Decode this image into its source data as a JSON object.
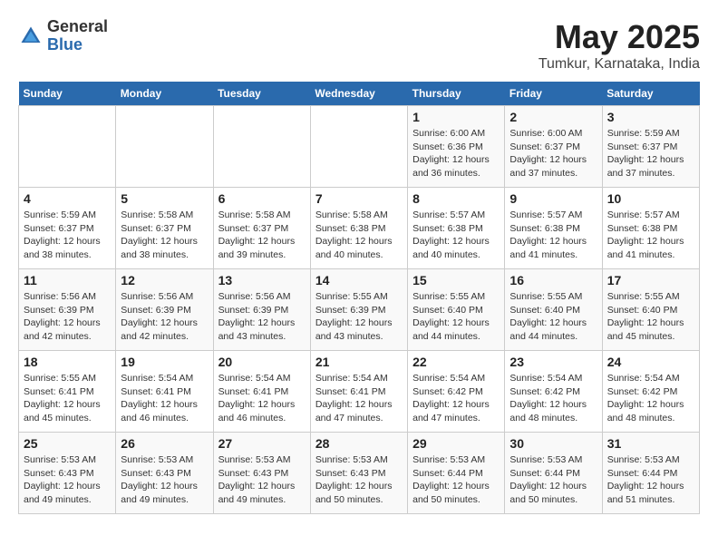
{
  "header": {
    "logo_general": "General",
    "logo_blue": "Blue",
    "month_title": "May 2025",
    "location": "Tumkur, Karnataka, India"
  },
  "days_of_week": [
    "Sunday",
    "Monday",
    "Tuesday",
    "Wednesday",
    "Thursday",
    "Friday",
    "Saturday"
  ],
  "weeks": [
    [
      {
        "day": "",
        "info": ""
      },
      {
        "day": "",
        "info": ""
      },
      {
        "day": "",
        "info": ""
      },
      {
        "day": "",
        "info": ""
      },
      {
        "day": "1",
        "info": "Sunrise: 6:00 AM\nSunset: 6:36 PM\nDaylight: 12 hours\nand 36 minutes."
      },
      {
        "day": "2",
        "info": "Sunrise: 6:00 AM\nSunset: 6:37 PM\nDaylight: 12 hours\nand 37 minutes."
      },
      {
        "day": "3",
        "info": "Sunrise: 5:59 AM\nSunset: 6:37 PM\nDaylight: 12 hours\nand 37 minutes."
      }
    ],
    [
      {
        "day": "4",
        "info": "Sunrise: 5:59 AM\nSunset: 6:37 PM\nDaylight: 12 hours\nand 38 minutes."
      },
      {
        "day": "5",
        "info": "Sunrise: 5:58 AM\nSunset: 6:37 PM\nDaylight: 12 hours\nand 38 minutes."
      },
      {
        "day": "6",
        "info": "Sunrise: 5:58 AM\nSunset: 6:37 PM\nDaylight: 12 hours\nand 39 minutes."
      },
      {
        "day": "7",
        "info": "Sunrise: 5:58 AM\nSunset: 6:38 PM\nDaylight: 12 hours\nand 40 minutes."
      },
      {
        "day": "8",
        "info": "Sunrise: 5:57 AM\nSunset: 6:38 PM\nDaylight: 12 hours\nand 40 minutes."
      },
      {
        "day": "9",
        "info": "Sunrise: 5:57 AM\nSunset: 6:38 PM\nDaylight: 12 hours\nand 41 minutes."
      },
      {
        "day": "10",
        "info": "Sunrise: 5:57 AM\nSunset: 6:38 PM\nDaylight: 12 hours\nand 41 minutes."
      }
    ],
    [
      {
        "day": "11",
        "info": "Sunrise: 5:56 AM\nSunset: 6:39 PM\nDaylight: 12 hours\nand 42 minutes."
      },
      {
        "day": "12",
        "info": "Sunrise: 5:56 AM\nSunset: 6:39 PM\nDaylight: 12 hours\nand 42 minutes."
      },
      {
        "day": "13",
        "info": "Sunrise: 5:56 AM\nSunset: 6:39 PM\nDaylight: 12 hours\nand 43 minutes."
      },
      {
        "day": "14",
        "info": "Sunrise: 5:55 AM\nSunset: 6:39 PM\nDaylight: 12 hours\nand 43 minutes."
      },
      {
        "day": "15",
        "info": "Sunrise: 5:55 AM\nSunset: 6:40 PM\nDaylight: 12 hours\nand 44 minutes."
      },
      {
        "day": "16",
        "info": "Sunrise: 5:55 AM\nSunset: 6:40 PM\nDaylight: 12 hours\nand 44 minutes."
      },
      {
        "day": "17",
        "info": "Sunrise: 5:55 AM\nSunset: 6:40 PM\nDaylight: 12 hours\nand 45 minutes."
      }
    ],
    [
      {
        "day": "18",
        "info": "Sunrise: 5:55 AM\nSunset: 6:41 PM\nDaylight: 12 hours\nand 45 minutes."
      },
      {
        "day": "19",
        "info": "Sunrise: 5:54 AM\nSunset: 6:41 PM\nDaylight: 12 hours\nand 46 minutes."
      },
      {
        "day": "20",
        "info": "Sunrise: 5:54 AM\nSunset: 6:41 PM\nDaylight: 12 hours\nand 46 minutes."
      },
      {
        "day": "21",
        "info": "Sunrise: 5:54 AM\nSunset: 6:41 PM\nDaylight: 12 hours\nand 47 minutes."
      },
      {
        "day": "22",
        "info": "Sunrise: 5:54 AM\nSunset: 6:42 PM\nDaylight: 12 hours\nand 47 minutes."
      },
      {
        "day": "23",
        "info": "Sunrise: 5:54 AM\nSunset: 6:42 PM\nDaylight: 12 hours\nand 48 minutes."
      },
      {
        "day": "24",
        "info": "Sunrise: 5:54 AM\nSunset: 6:42 PM\nDaylight: 12 hours\nand 48 minutes."
      }
    ],
    [
      {
        "day": "25",
        "info": "Sunrise: 5:53 AM\nSunset: 6:43 PM\nDaylight: 12 hours\nand 49 minutes."
      },
      {
        "day": "26",
        "info": "Sunrise: 5:53 AM\nSunset: 6:43 PM\nDaylight: 12 hours\nand 49 minutes."
      },
      {
        "day": "27",
        "info": "Sunrise: 5:53 AM\nSunset: 6:43 PM\nDaylight: 12 hours\nand 49 minutes."
      },
      {
        "day": "28",
        "info": "Sunrise: 5:53 AM\nSunset: 6:43 PM\nDaylight: 12 hours\nand 50 minutes."
      },
      {
        "day": "29",
        "info": "Sunrise: 5:53 AM\nSunset: 6:44 PM\nDaylight: 12 hours\nand 50 minutes."
      },
      {
        "day": "30",
        "info": "Sunrise: 5:53 AM\nSunset: 6:44 PM\nDaylight: 12 hours\nand 50 minutes."
      },
      {
        "day": "31",
        "info": "Sunrise: 5:53 AM\nSunset: 6:44 PM\nDaylight: 12 hours\nand 51 minutes."
      }
    ]
  ]
}
